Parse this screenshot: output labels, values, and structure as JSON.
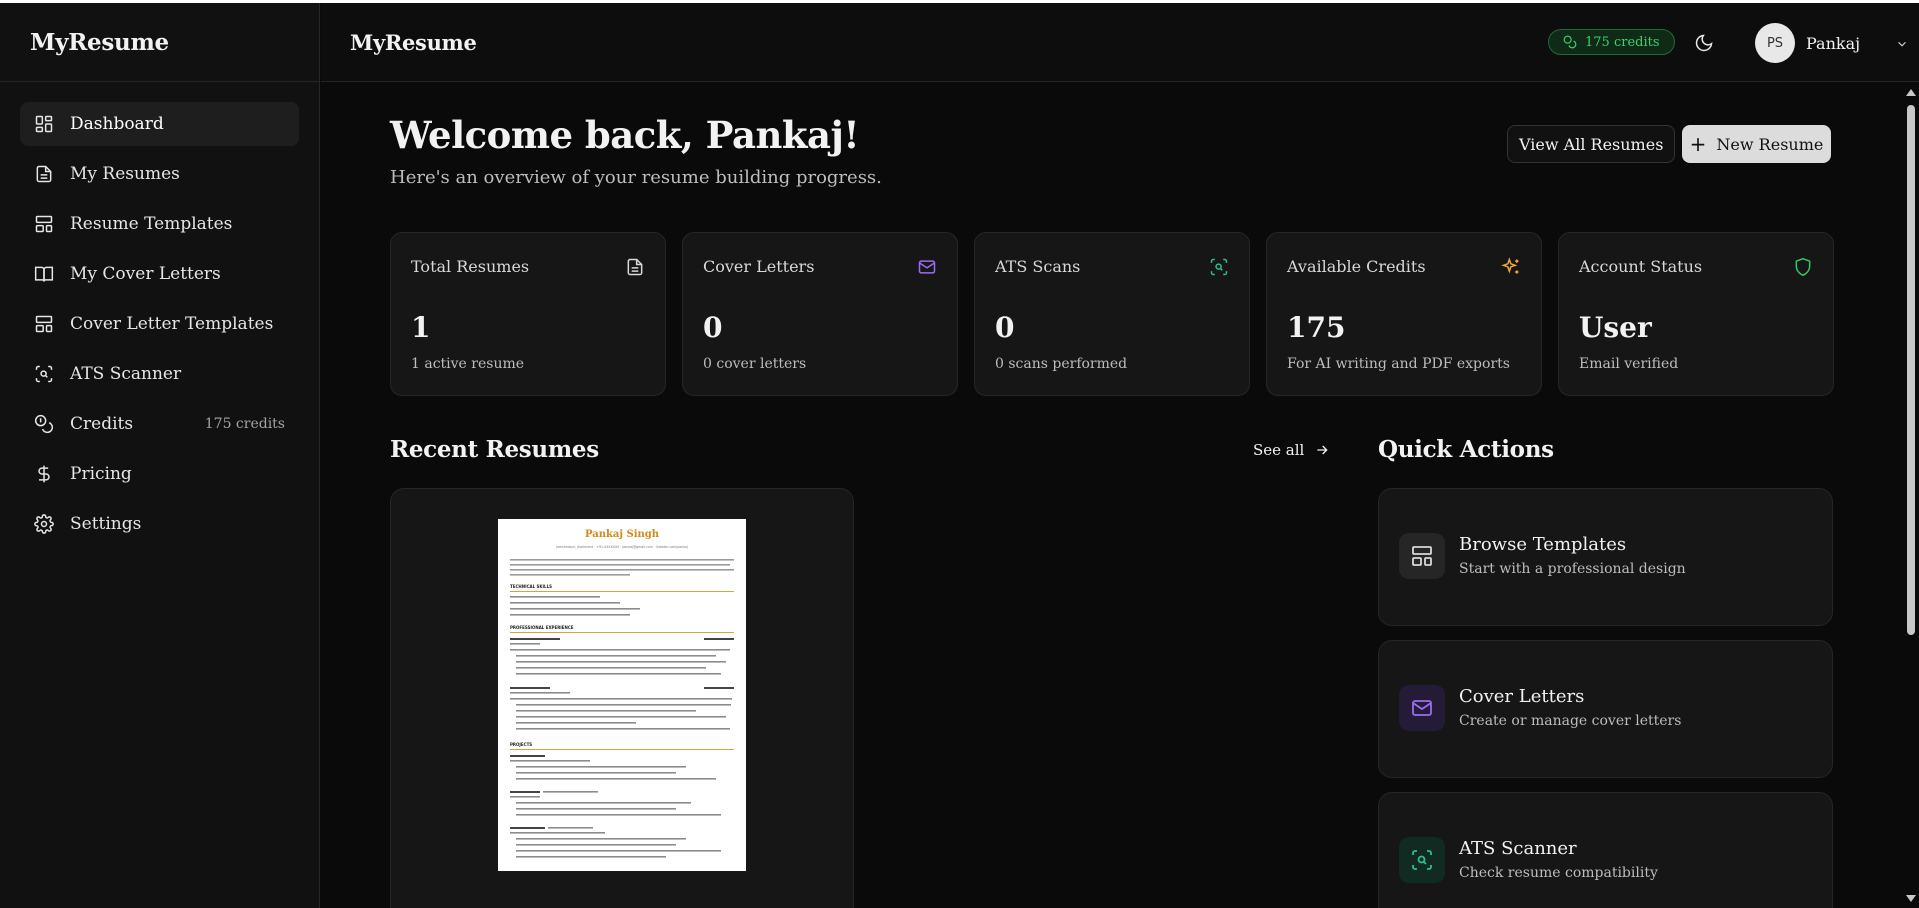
{
  "app": {
    "brand": "MyResume",
    "header_title": "MyResume"
  },
  "sidebar": {
    "items": [
      {
        "label": "Dashboard",
        "icon": "dashboard-icon",
        "active": true
      },
      {
        "label": "My Resumes",
        "icon": "file-icon"
      },
      {
        "label": "Resume Templates",
        "icon": "layout-icon"
      },
      {
        "label": "My Cover Letters",
        "icon": "book-icon"
      },
      {
        "label": "Cover Letter Templates",
        "icon": "layout-icon"
      },
      {
        "label": "ATS Scanner",
        "icon": "scan-icon"
      },
      {
        "label": "Credits",
        "icon": "coins-icon",
        "badge": "175 credits"
      },
      {
        "label": "Pricing",
        "icon": "dollar-icon"
      },
      {
        "label": "Settings",
        "icon": "gear-icon"
      }
    ]
  },
  "header": {
    "credits": "175 credits",
    "avatar_initials": "PS",
    "user_name": "Pankaj"
  },
  "main": {
    "welcome": "Welcome back, Pankaj!",
    "subtitle": "Here's an overview of your resume building progress.",
    "view_all_label": "View All Resumes",
    "new_resume_label": "New Resume",
    "stats": [
      {
        "label": "Total Resumes",
        "value": "1",
        "sub": "1 active resume",
        "icon": "file-icon",
        "color": "#d9d9d9"
      },
      {
        "label": "Cover Letters",
        "value": "0",
        "sub": "0 cover letters",
        "icon": "mail-icon",
        "color": "#9b6cf6"
      },
      {
        "label": "ATS Scans",
        "value": "0",
        "sub": "0 scans performed",
        "icon": "scan-icon",
        "color": "#2bbf8a"
      },
      {
        "label": "Available Credits",
        "value": "175",
        "sub": "For AI writing and PDF exports",
        "icon": "sparkles-icon",
        "color": "#f2a93b"
      },
      {
        "label": "Account Status",
        "value": "User",
        "sub": "Email verified",
        "icon": "shield-icon",
        "color": "#32c766"
      }
    ],
    "recent_title": "Recent Resumes",
    "see_all": "See all",
    "resume_preview": {
      "name": "Pankaj Singh",
      "contact": "Jamshedpur, Jharkhand · +91-XXXXXXX · pankaj@gmail.com · linkedin.com/pankaj",
      "sections": [
        "TECHNICAL SKILLS",
        "PROFESSIONAL EXPERIENCE",
        "PROJECTS"
      ]
    },
    "quick_title": "Quick Actions",
    "quick_actions": [
      {
        "title": "Browse Templates",
        "sub": "Start with a professional design",
        "icon": "layout-icon",
        "color": "#d9d9d9",
        "bg": "#262626"
      },
      {
        "title": "Cover Letters",
        "sub": "Create or manage cover letters",
        "icon": "mail-icon",
        "color": "#9b6cf6",
        "bg": "#241b36"
      },
      {
        "title": "ATS Scanner",
        "sub": "Check resume compatibility",
        "icon": "scan-icon",
        "color": "#2bbf8a",
        "bg": "#112a22"
      }
    ]
  }
}
